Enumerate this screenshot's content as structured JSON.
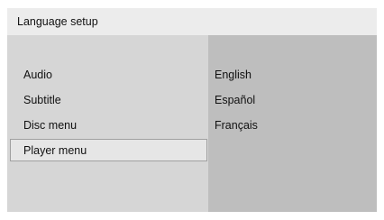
{
  "header": {
    "title": "Language setup"
  },
  "menu": {
    "items": [
      {
        "label": "Audio"
      },
      {
        "label": "Subtitle"
      },
      {
        "label": "Disc menu"
      },
      {
        "label": "Player menu",
        "selected": true
      }
    ]
  },
  "options": {
    "items": [
      {
        "label": "English"
      },
      {
        "label": "Español"
      },
      {
        "label": "Français"
      }
    ]
  },
  "colors": {
    "header_bg": "#ececec",
    "menu_bg": "#d6d6d6",
    "options_bg": "#bebebe",
    "selected_bg": "#e6e6e6",
    "selected_border": "#a0a0a0"
  }
}
